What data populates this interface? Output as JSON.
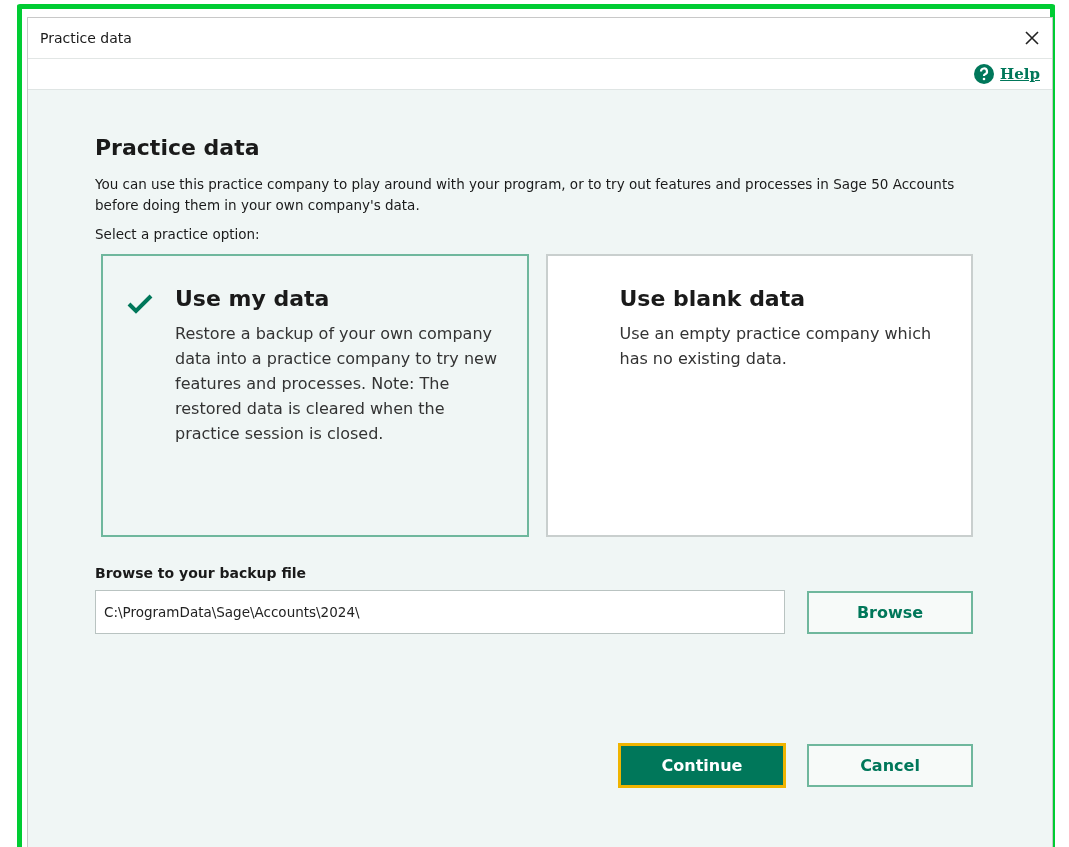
{
  "window": {
    "title": "Practice data"
  },
  "help_link": "Help",
  "heading": "Practice data",
  "description": "You can use this practice company to play around with your program, or to try out features and processes in Sage 50 Accounts before doing them in your own company's data.",
  "prompt": "Select a practice option:",
  "options": [
    {
      "title": "Use my data",
      "description": "Restore a backup of your own company data into a practice company to try new features and processes. Note: The restored data is cleared when the practice session is closed.",
      "selected": true
    },
    {
      "title": "Use blank data",
      "description": "Use an empty practice company which has no existing data.",
      "selected": false
    }
  ],
  "backup": {
    "label": "Browse to your backup file",
    "value": "C:\\ProgramData\\Sage\\Accounts\\2024\\",
    "button": "Browse"
  },
  "buttons": [
    {
      "label": "Continue",
      "kind": "primary"
    },
    {
      "label": "Cancel",
      "kind": "secondary"
    }
  ]
}
